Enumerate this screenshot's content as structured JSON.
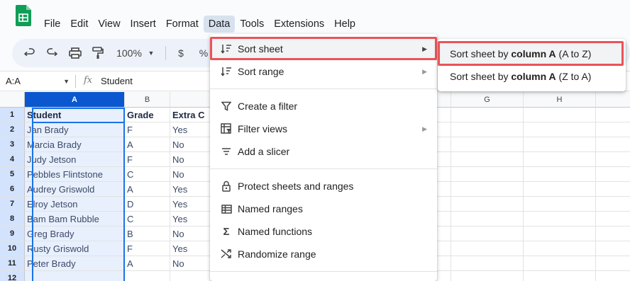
{
  "menubar": {
    "items": [
      "File",
      "Edit",
      "View",
      "Insert",
      "Format",
      "Data",
      "Tools",
      "Extensions",
      "Help"
    ],
    "active": "Data"
  },
  "toolbar": {
    "zoom": "100%",
    "currency": "$",
    "percent": "%"
  },
  "formula_bar": {
    "name_box": "A:A",
    "fx": "fx",
    "value": "Student"
  },
  "grid": {
    "columns": [
      "A",
      "B",
      "C",
      "G",
      "H"
    ],
    "rows": [
      "1",
      "2",
      "3",
      "4",
      "5",
      "6",
      "7",
      "8",
      "9",
      "10",
      "11",
      "12"
    ],
    "col_a": [
      "Student",
      "Jan Brady",
      "Marcia Brady",
      "Judy Jetson",
      "Pebbles Flintstone",
      "Audrey Griswold",
      "Elroy Jetson",
      "Bam Bam Rubble",
      "Greg Brady",
      "Rusty Griswold",
      "Peter Brady"
    ],
    "col_b": [
      "Grade",
      "F",
      "A",
      "F",
      "C",
      "A",
      "D",
      "C",
      "B",
      "F",
      "A"
    ],
    "col_c": [
      "Extra C",
      "Yes",
      "No",
      "No",
      "No",
      "Yes",
      "Yes",
      "Yes",
      "No",
      "Yes",
      "No"
    ]
  },
  "data_menu": {
    "items": [
      {
        "label": "Sort sheet",
        "icon": "sort-icon",
        "has_submenu": true
      },
      {
        "label": "Sort range",
        "icon": "sort-icon",
        "has_submenu": true
      },
      {
        "label": "Create a filter",
        "icon": "filter-icon",
        "has_submenu": false
      },
      {
        "label": "Filter views",
        "icon": "filter-views-icon",
        "has_submenu": true
      },
      {
        "label": "Add a slicer",
        "icon": "slicer-icon",
        "has_submenu": false
      },
      {
        "label": "Protect sheets and ranges",
        "icon": "lock-icon",
        "has_submenu": false
      },
      {
        "label": "Named ranges",
        "icon": "table-icon",
        "has_submenu": false
      },
      {
        "label": "Named functions",
        "icon": "sigma-icon",
        "has_submenu": false
      },
      {
        "label": "Randomize range",
        "icon": "shuffle-icon",
        "has_submenu": false
      }
    ]
  },
  "submenu": {
    "az": {
      "prefix": "Sort sheet by ",
      "bold": "column A",
      "suffix": " (A to Z)"
    },
    "za": {
      "prefix": "Sort sheet by ",
      "bold": "column A",
      "suffix": " (Z to A)"
    }
  },
  "colors": {
    "accent": "#0b57d0",
    "highlight_border": "#e8545a",
    "selection_fill": "#e8f0fe"
  }
}
